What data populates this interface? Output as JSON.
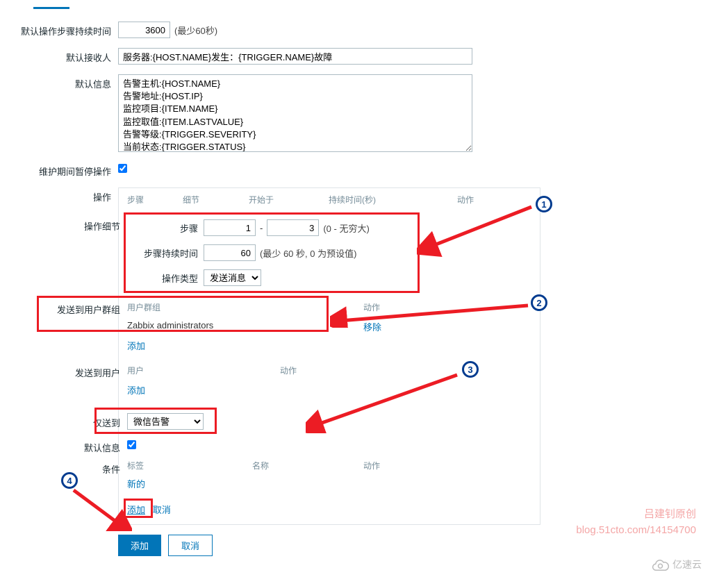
{
  "labels": {
    "default_step_duration": "默认操作步骤持续时间",
    "default_recipient": "默认接收人",
    "default_message": "默认信息",
    "pause_maintenance": "维护期间暂停操作",
    "operations": "操作",
    "operation_detail": "操作细节",
    "send_to_user_groups": "发送到用户群组",
    "send_to_users": "发送到用户",
    "only_send_to": "仅送到",
    "default_info_cb": "默认信息",
    "conditions": "条件"
  },
  "values": {
    "step_duration": "3600",
    "step_duration_hint": "(最少60秒)",
    "recipient": "服务器:{HOST.NAME}发生：{TRIGGER.NAME}故障",
    "message": "告警主机:{HOST.NAME}\n告警地址:{HOST.IP}\n监控项目:{ITEM.NAME}\n监控取值:{ITEM.LASTVALUE}\n告警等级:{TRIGGER.SEVERITY}\n当前状态:{TRIGGER.STATUS}",
    "step_from": "1",
    "step_to": "3",
    "step_range_hint": "(0 - 无穷大)",
    "step_duration2": "60",
    "step_duration2_hint": "(最少 60 秒, 0 为预设值)",
    "op_type_selected": "发送消息",
    "only_to_selected": "微信告警",
    "user_group_value": "Zabbix administrators"
  },
  "ops_columns": {
    "c1": "步骤",
    "c2": "细节",
    "c3": "开始于",
    "c4": "持续时间(秒)",
    "c5": "动作"
  },
  "sub_labels": {
    "step": "步骤",
    "step_duration": "步骤持续时间",
    "op_type": "操作类型"
  },
  "group_table": {
    "h1": "用户群组",
    "h2": "动作",
    "remove": "移除",
    "add": "添加"
  },
  "user_table": {
    "h1": "用户",
    "h2": "动作",
    "add": "添加"
  },
  "cond_table": {
    "h1": "标签",
    "h2": "名称",
    "h3": "动作",
    "new": "新的"
  },
  "buttons": {
    "add": "添加",
    "cancel": "取消"
  },
  "watermark": {
    "l1": "吕建钊原创",
    "l2": "blog.51cto.com/14154700"
  },
  "brand": "亿速云",
  "badges": {
    "b1": "1",
    "b2": "2",
    "b3": "3",
    "b4": "4"
  }
}
